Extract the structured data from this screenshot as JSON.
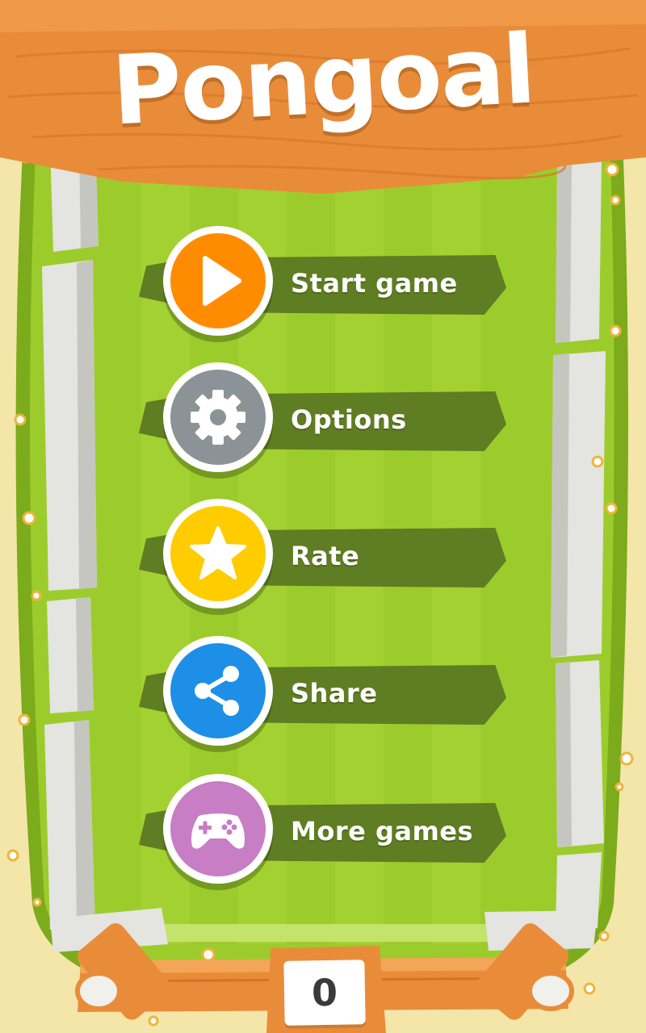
{
  "app": {
    "title": "Pongoal"
  },
  "menu": {
    "items": [
      {
        "id": "start",
        "label": "Start game",
        "icon": "play-icon",
        "color": "#ff8c00"
      },
      {
        "id": "options",
        "label": "Options",
        "icon": "gear-icon",
        "color": "#8c9396"
      },
      {
        "id": "rate",
        "label": "Rate",
        "icon": "star-icon",
        "color": "#ffcc00"
      },
      {
        "id": "share",
        "label": "Share",
        "icon": "share-icon",
        "color": "#1e8fe6"
      },
      {
        "id": "more",
        "label": "More games",
        "icon": "gamepad-icon",
        "color": "#c77ec5"
      }
    ]
  },
  "score": {
    "value": "0"
  },
  "colors": {
    "grass": "#9ccc2c",
    "grass_light": "#aad63a",
    "sand": "#f3e6a8",
    "wood": "#e98c3a",
    "banner": "#5f7d22",
    "wall": "#e4e4e0"
  }
}
